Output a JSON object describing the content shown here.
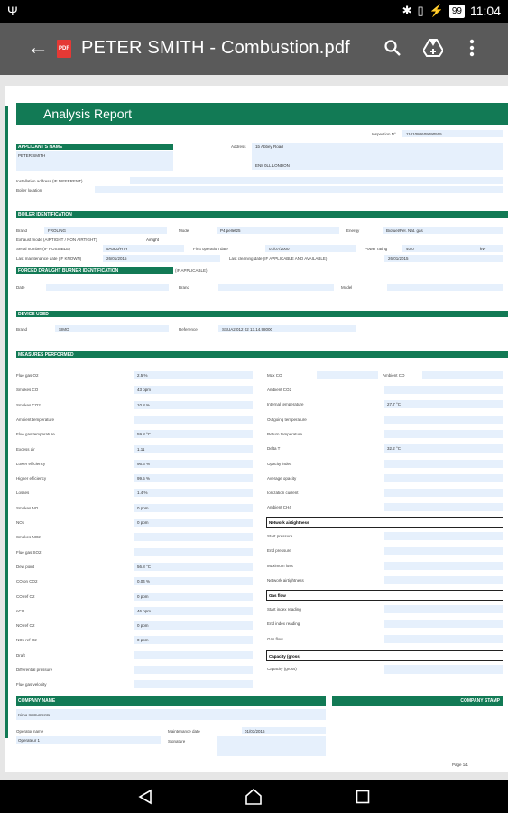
{
  "status_bar": {
    "time": "11:04",
    "battery": "99"
  },
  "app_bar": {
    "title": "PETER SMITH - Combustion.pdf",
    "pdf_badge": "PDF"
  },
  "report": {
    "title": "Analysis Report",
    "inspection_label": "Inspection N°",
    "inspection_number": "1101080609090505",
    "applicants_header": "APPLICANT'S NAME",
    "applicant_name": "PETER SMITH",
    "address_label": "Address",
    "address_line1": "1b Abbey Road",
    "address_line2": "EN8 0LL LONDON",
    "installation_address_label": "Installation address (IF DIFFERENT)",
    "boiler_location_label": "Boiler location",
    "boiler_header": "BOILER IDENTIFICATION",
    "brand_label": "Brand",
    "brand_value": "FROLING",
    "model_label": "Model",
    "model_value": "P4 pellet25",
    "energy_label": "Energy",
    "energy_value": "Biofuel/Pel. Nat. gas",
    "exhaust_label": "Exhaust mode (AIRTIGHT / NON AIRTIGHT)",
    "exhaust_value": "Airtight",
    "serial_label": "Serial number (IF POSSIBLE)",
    "serial_value": "5A0K0/HTY",
    "first_op_label": "First operation date",
    "first_op_value": "01/07/2000",
    "power_label": "Power rating",
    "power_value": "40.0",
    "power_unit": "kW",
    "last_maint_label": "Last maintenance date (IF KNOWN)",
    "last_maint_value": "26/01/2015",
    "last_clean_label": "Last cleaning date (IF APPLICABLE AND AVAILABLE)",
    "last_clean_value": "26/01/2015",
    "forced_header": "FORCED DRAUGHT BURNER IDENTIFICATION",
    "forced_note": "(IF APPLICABLE)",
    "date_label": "Date",
    "device_header": "DEVICE USED",
    "device_brand_value": "SIMO",
    "reference_label": "Reference",
    "reference_value": "SSUA2 012 02 13.14.98000",
    "measures_header": "MEASURES PERFORMED",
    "left_measures": [
      {
        "label": "Flue gas O2",
        "value": "2.5 %"
      },
      {
        "label": "Smokes CO",
        "value": "43 ppm"
      },
      {
        "label": "Smokes CO2",
        "value": "10.8 %"
      },
      {
        "label": "Ambient temperature",
        "value": ""
      },
      {
        "label": "Flue gas temperature",
        "value": "59.8 °C"
      },
      {
        "label": "Excess air",
        "value": "1.11"
      },
      {
        "label": "Lower efficiency",
        "value": "96.6 %"
      },
      {
        "label": "Higher efficiency",
        "value": "99.5 %"
      },
      {
        "label": "Losses",
        "value": "1.4 %"
      },
      {
        "label": "Smokes NO",
        "value": "0 ppm"
      },
      {
        "label": "NOx",
        "value": "0 ppm"
      },
      {
        "label": "Smokes NO2",
        "value": ""
      },
      {
        "label": "Flue gas SO2",
        "value": ""
      },
      {
        "label": "Dew point",
        "value": "56.8 °C"
      },
      {
        "label": "CO on CO2",
        "value": "0.04 %"
      },
      {
        "label": "CO ref O2",
        "value": "0 ppm"
      },
      {
        "label": "nCO",
        "value": "46 ppm"
      },
      {
        "label": "NO ref O2",
        "value": "0 ppm"
      },
      {
        "label": "NOx ref O2",
        "value": "0 ppm"
      },
      {
        "label": "Draft",
        "value": ""
      },
      {
        "label": "Differential pressure",
        "value": ""
      },
      {
        "label": "Flue gas velocity",
        "value": ""
      }
    ],
    "max_co_label": "Max CO",
    "ambient_co_label": "Ambient CO",
    "right_measures": [
      {
        "label": "Ambient CO2",
        "value": ""
      },
      {
        "label": "Internal temperature",
        "value": "27.7 °C"
      },
      {
        "label": "Outgoing temperature",
        "value": ""
      },
      {
        "label": "Return temperature",
        "value": ""
      },
      {
        "label": "Delta T",
        "value": "32.2 °C"
      },
      {
        "label": "Opacity index",
        "value": ""
      },
      {
        "label": "Average opacity",
        "value": ""
      },
      {
        "label": "Ionization current",
        "value": ""
      },
      {
        "label": "Ambient CH4",
        "value": ""
      }
    ],
    "network_header": "Network airtightness",
    "network_items": [
      "Start pressure",
      "End pressure",
      "Maximum loss",
      "Network airtightness"
    ],
    "gas_flow_header": "Gas flow",
    "gas_flow_items": [
      "Start index reading",
      "End index reading",
      "Gas flow"
    ],
    "capacity_header": "Capacity (gross)",
    "capacity_item": "Capacity (gross)",
    "company_header": "COMPANY NAME",
    "company_name": "Kimo Instruments",
    "stamp_header": "COMPANY STAMP",
    "operator_label": "Operator name",
    "operator_value": "Operateur 1",
    "maint_date_label": "Maintenance date",
    "maint_date_value": "01/03/2016",
    "signature_label": "Signature",
    "page_label": "Page 1/1"
  }
}
